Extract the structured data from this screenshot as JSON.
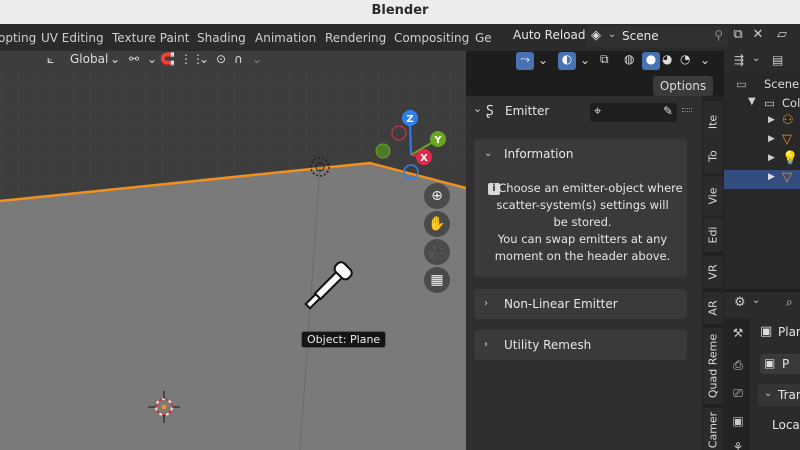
{
  "window": {
    "title": "Blender"
  },
  "workspaces": [
    "opting",
    "UV Editing",
    "Texture Paint",
    "Shading",
    "Animation",
    "Rendering",
    "Compositing",
    "Ge"
  ],
  "topbar": {
    "auto_reload": "Auto Reload",
    "scene_label": "Scene"
  },
  "viewport": {
    "orientation": "Global",
    "options_label": "Options",
    "tooltip": "Object: Plane",
    "gizmo_axes": {
      "z": "Z",
      "y": "Y",
      "x": "X"
    }
  },
  "sidebar": {
    "header_title": "Emitter",
    "info_panel": {
      "title": "Information",
      "lines": [
        "Choose an emitter-object where",
        "scatter-system(s) settings will",
        "be stored.",
        "You can swap emitters at any",
        "moment on the header above."
      ]
    },
    "nonlinear_panel": {
      "title": "Non-Linear Emitter"
    },
    "remesh_panel": {
      "title": "Utility Remesh"
    },
    "tabs": [
      "Ite",
      "To",
      "Vie",
      "Edi",
      "VR",
      "AR",
      "Quad Reme",
      "Camer"
    ]
  },
  "outliner": {
    "scene_row": "Scene c",
    "collection_row": "Col"
  },
  "properties": {
    "object_name": "Plan",
    "field_value": "P",
    "transform_label": "Tran",
    "location_label": "Locat"
  },
  "colors": {
    "accent_blue": "#4772b3",
    "selection_orange": "#f0901e",
    "axis_x": "#e2294d",
    "axis_y": "#6aa61f",
    "axis_z": "#2f80ed"
  }
}
